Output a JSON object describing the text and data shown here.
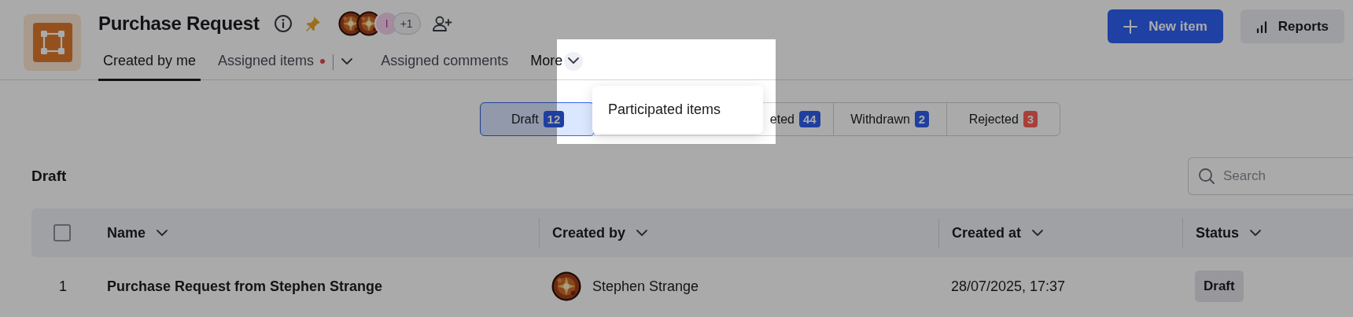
{
  "header": {
    "title": "Purchase Request",
    "pinned": true,
    "avatars": [
      {
        "kind": "picture"
      },
      {
        "kind": "picture"
      },
      {
        "kind": "initial",
        "initial": "I"
      }
    ],
    "more_avatars": "+1"
  },
  "actions": [
    {
      "label": "New item",
      "kind": "primary"
    },
    {
      "label": "Reports",
      "kind": "secondary"
    }
  ],
  "tabs": [
    {
      "label": "Created by me",
      "selected": true,
      "notification": false,
      "dropdown": false
    },
    {
      "label": "Assigned items",
      "selected": false,
      "notification": true,
      "dropdown": true
    },
    {
      "label": "Assigned comments",
      "selected": false,
      "notification": false,
      "dropdown": false
    },
    {
      "label": "More",
      "selected": false,
      "notification": false,
      "dropdown": true
    }
  ],
  "more_menu": {
    "open": true,
    "items": [
      {
        "label": "Participated items"
      }
    ]
  },
  "status_filter": [
    {
      "label": "Draft",
      "count": "12",
      "selected": true,
      "color": "#1f3f9f"
    },
    {
      "label": "eted",
      "count": "44",
      "selected": false,
      "color": "#1f3f9f"
    },
    {
      "label": "Withdrawn",
      "count": "2",
      "selected": false,
      "color": "#1f3f9f"
    },
    {
      "label": "Rejected",
      "count": "3",
      "selected": false,
      "color": "#a8403a"
    }
  ],
  "section_title": "Draft",
  "search": {
    "placeholder": "Search"
  },
  "table": {
    "select_all_checked": false,
    "columns": [
      "Name",
      "Created by",
      "Created at",
      "Status"
    ],
    "rows": [
      {
        "number": "1",
        "name": "Purchase Request from Stephen Strange",
        "created_by": {
          "name": "Stephen Strange",
          "avatar": {
            "kind": "picture"
          }
        },
        "created_at": "28/07/2025, 17:37",
        "status": "Draft"
      }
    ]
  }
}
